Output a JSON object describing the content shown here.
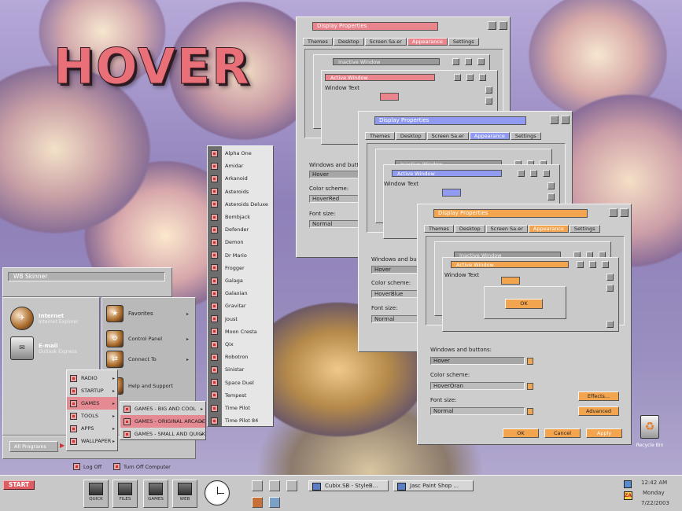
{
  "logo": "HOVER",
  "display_windows": [
    {
      "title": "Display Properties",
      "tabs": [
        "Themes",
        "Desktop",
        "Screen Sa.er",
        "Appearance",
        "Settings"
      ],
      "inactive_title": "Inactive Window",
      "active_title": "Active Window",
      "window_text": "Window Text",
      "wb_label": "Windows and butto",
      "wb_value": "Hover",
      "scheme_label": "Color scheme:",
      "scheme_value": "HoverRed",
      "font_label": "Font size:",
      "font_value": "Normal",
      "accent": "#e9868d"
    },
    {
      "title": "Display Properties",
      "tabs": [
        "Themes",
        "Desktop",
        "Screen Sa.er",
        "Appearance",
        "Settings"
      ],
      "inactive_title": "Inactive Window",
      "active_title": "Active Window",
      "window_text": "Window Text",
      "wb_label": "Windows and butto",
      "wb_value": "Hover",
      "scheme_label": "Color scheme:",
      "scheme_value": "HoverBlue",
      "font_label": "Font size:",
      "font_value": "Normal",
      "accent": "#8f9af0"
    },
    {
      "title": "Display Properties",
      "tabs": [
        "Themes",
        "Desktop",
        "Screen Sa.er",
        "Appearance",
        "Settings"
      ],
      "inactive_title": "Inactive Window",
      "active_title": "Active Window",
      "window_text": "Window Text",
      "ok_preview": "OK",
      "wb_label": "Windows and buttons:",
      "wb_value": "Hover",
      "scheme_label": "Color scheme:",
      "scheme_value": "HoverOran",
      "font_label": "Font size:",
      "font_value": "Normal",
      "effects": "Effects...",
      "advanced": "Advanced",
      "ok": "OK",
      "cancel": "Cancel",
      "apply": "Apply",
      "accent": "#f2a44e"
    }
  ],
  "start_menu": {
    "user": "WB Skinner",
    "pinned": [
      {
        "title": "Internet",
        "subtitle": "Internet Explorer",
        "icon": "browser-icon"
      },
      {
        "title": "E-mail",
        "subtitle": "Outlook Express",
        "icon": "mail-icon"
      }
    ],
    "right_items": [
      "Favorites",
      "Control Panel",
      "Connect To",
      "Help and Support"
    ],
    "all_programs": "All Programs",
    "log_off": "Log Off",
    "turn_off": "Turn Off Computer"
  },
  "programs_submenu": [
    "RADIO",
    "STARTUP",
    "GAMES",
    "TOOLS",
    "APPS",
    "WALLPAPER"
  ],
  "games_submenu": [
    "GAMES - BIG AND COOL",
    "GAMES - ORIGINAL ARCADE",
    "GAMES - SMALL AND QUICK"
  ],
  "arcade_games": [
    "Alpha One",
    "Amidar",
    "Arkanoid",
    "Asteroids",
    "Asteroids Deluxe",
    "Bombjack",
    "Defender",
    "Demon",
    "Dr Mario",
    "Frogger",
    "Galaga",
    "Galaxian",
    "Gravitar",
    "Joust",
    "Moon Cresta",
    "Qix",
    "Robotron",
    "Sinistar",
    "Space Duel",
    "Tempest",
    "Time Pilot",
    "Time Pilot 84"
  ],
  "taskbar": {
    "start": "START",
    "quick": [
      "QUICK",
      "FILES",
      "GAMES",
      "WEB"
    ],
    "tasks": [
      "Cubix.SB - StyleB...",
      "Jasc Paint Shop ..."
    ],
    "time": "12:42 AM",
    "day": "Monday",
    "date": "7/22/2003"
  },
  "desktop": {
    "recycle_bin": "Recycle Bin"
  }
}
